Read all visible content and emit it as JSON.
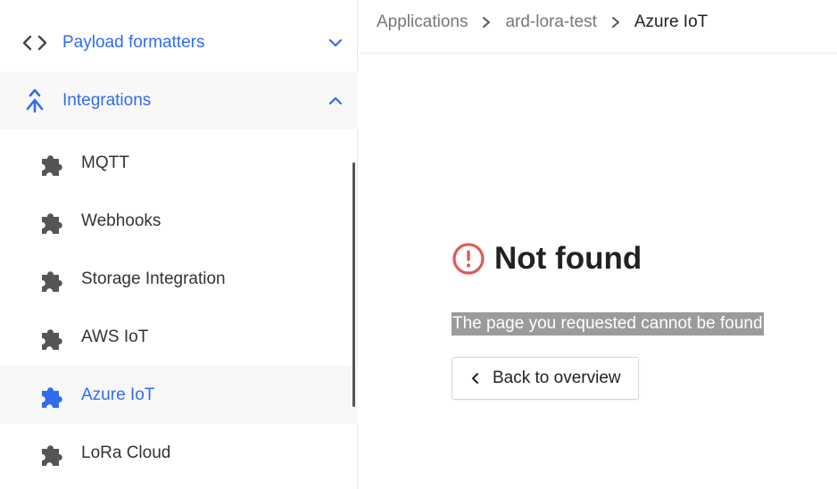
{
  "sidebar": {
    "formatters": {
      "label": "Payload formatters",
      "icon": "code-icon"
    },
    "integrations": {
      "label": "Integrations",
      "icon": "merge-icon"
    },
    "items": [
      {
        "label": "MQTT",
        "icon": "puzzle-icon"
      },
      {
        "label": "Webhooks",
        "icon": "puzzle-icon"
      },
      {
        "label": "Storage Integration",
        "icon": "puzzle-icon"
      },
      {
        "label": "AWS IoT",
        "icon": "puzzle-icon"
      },
      {
        "label": "Azure IoT",
        "icon": "puzzle-icon",
        "active": true
      },
      {
        "label": "LoRa Cloud",
        "icon": "puzzle-icon"
      }
    ]
  },
  "breadcrumb": [
    "Applications",
    "ard-lora-test",
    "Azure IoT"
  ],
  "notfound": {
    "title": "Not found",
    "message": "The page you requested cannot be found",
    "back_label": "Back to overview"
  },
  "colors": {
    "accent": "#2f6cf0",
    "error": "#e05a5a",
    "icon_gray": "#555555"
  }
}
